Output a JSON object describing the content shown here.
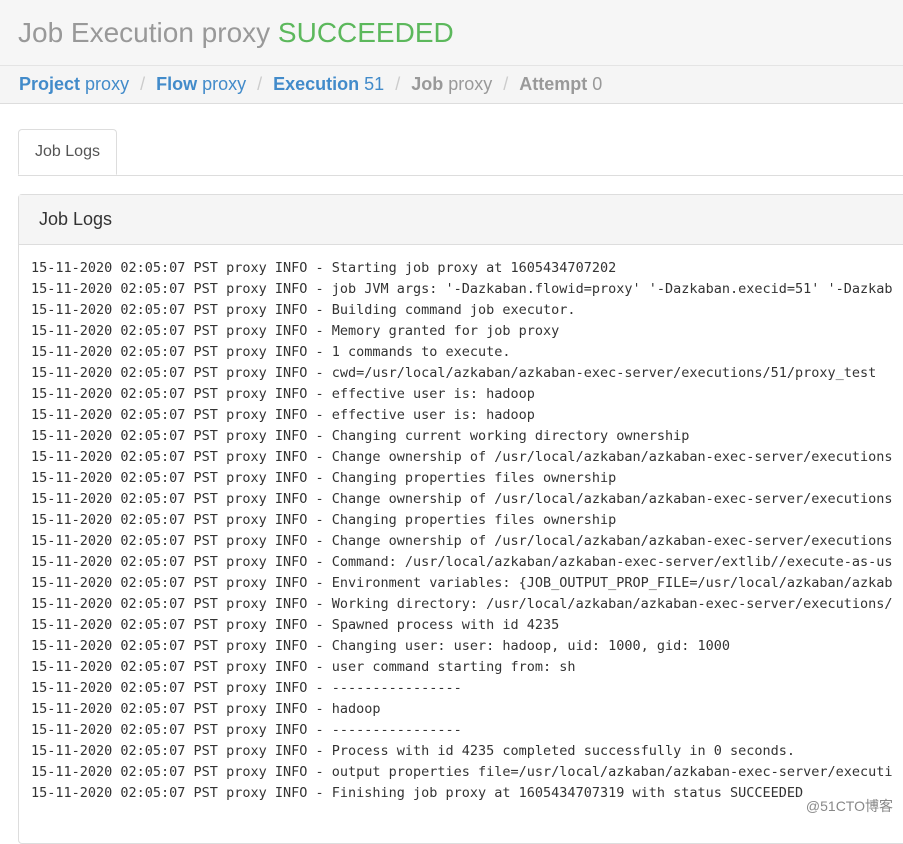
{
  "header": {
    "title": "Job Execution proxy",
    "status": "SUCCEEDED",
    "status_color": "#5cb85c"
  },
  "breadcrumb": [
    {
      "key": "Project",
      "value": "proxy"
    },
    {
      "key": "Flow",
      "value": "proxy"
    },
    {
      "key": "Execution",
      "value": "51"
    },
    {
      "key": "Job",
      "value": "proxy"
    },
    {
      "key": "Attempt",
      "value": "0"
    }
  ],
  "tabs": [
    {
      "label": "Job Logs"
    }
  ],
  "panel": {
    "title": "Job Logs"
  },
  "log_prefix": "15-11-2020 02:05:07 PST proxy INFO - ",
  "logs": [
    "Starting job proxy at 1605434707202",
    "job JVM args: '-Dazkaban.flowid=proxy' '-Dazkaban.execid=51' '-Dazkab",
    "Building command job executor.",
    "Memory granted for job proxy",
    "1 commands to execute.",
    "cwd=/usr/local/azkaban/azkaban-exec-server/executions/51/proxy_test",
    "effective user is: hadoop",
    "effective user is: hadoop",
    "Changing current working directory ownership",
    "Change ownership of /usr/local/azkaban/azkaban-exec-server/executions",
    "Changing properties files ownership",
    "Change ownership of /usr/local/azkaban/azkaban-exec-server/executions",
    "Changing properties files ownership",
    "Change ownership of /usr/local/azkaban/azkaban-exec-server/executions",
    "Command: /usr/local/azkaban/azkaban-exec-server/extlib//execute-as-us",
    "Environment variables: {JOB_OUTPUT_PROP_FILE=/usr/local/azkaban/azkab",
    "Working directory: /usr/local/azkaban/azkaban-exec-server/executions/",
    "Spawned process with id 4235",
    "Changing user: user: hadoop, uid: 1000, gid: 1000",
    "user command starting from: sh",
    "----------------",
    "hadoop",
    "----------------",
    "Process with id 4235 completed successfully in 0 seconds.",
    "output properties file=/usr/local/azkaban/azkaban-exec-server/executi",
    "Finishing job proxy at 1605434707319 with status SUCCEEDED"
  ],
  "watermark": "@51CTO博客"
}
